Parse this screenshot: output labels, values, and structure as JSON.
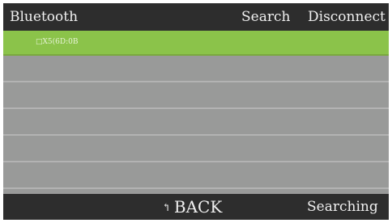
{
  "header": {
    "title": "Bluetooth",
    "search_label": "Search",
    "disconnect_label": "Disconnect"
  },
  "devices": [
    {
      "name": "□X5(6D:0B",
      "selected": true
    },
    {
      "name": "",
      "selected": false
    },
    {
      "name": "",
      "selected": false
    },
    {
      "name": "",
      "selected": false
    },
    {
      "name": "",
      "selected": false
    },
    {
      "name": "",
      "selected": false
    }
  ],
  "footer": {
    "back_icon": "back-arrow-icon",
    "back_label": "BACK",
    "status": "Searching"
  },
  "colors": {
    "bar_background": "#2d2d2d",
    "list_background": "#999a99",
    "selected_row": "#8bc34a",
    "text": "#f0f0f0"
  }
}
